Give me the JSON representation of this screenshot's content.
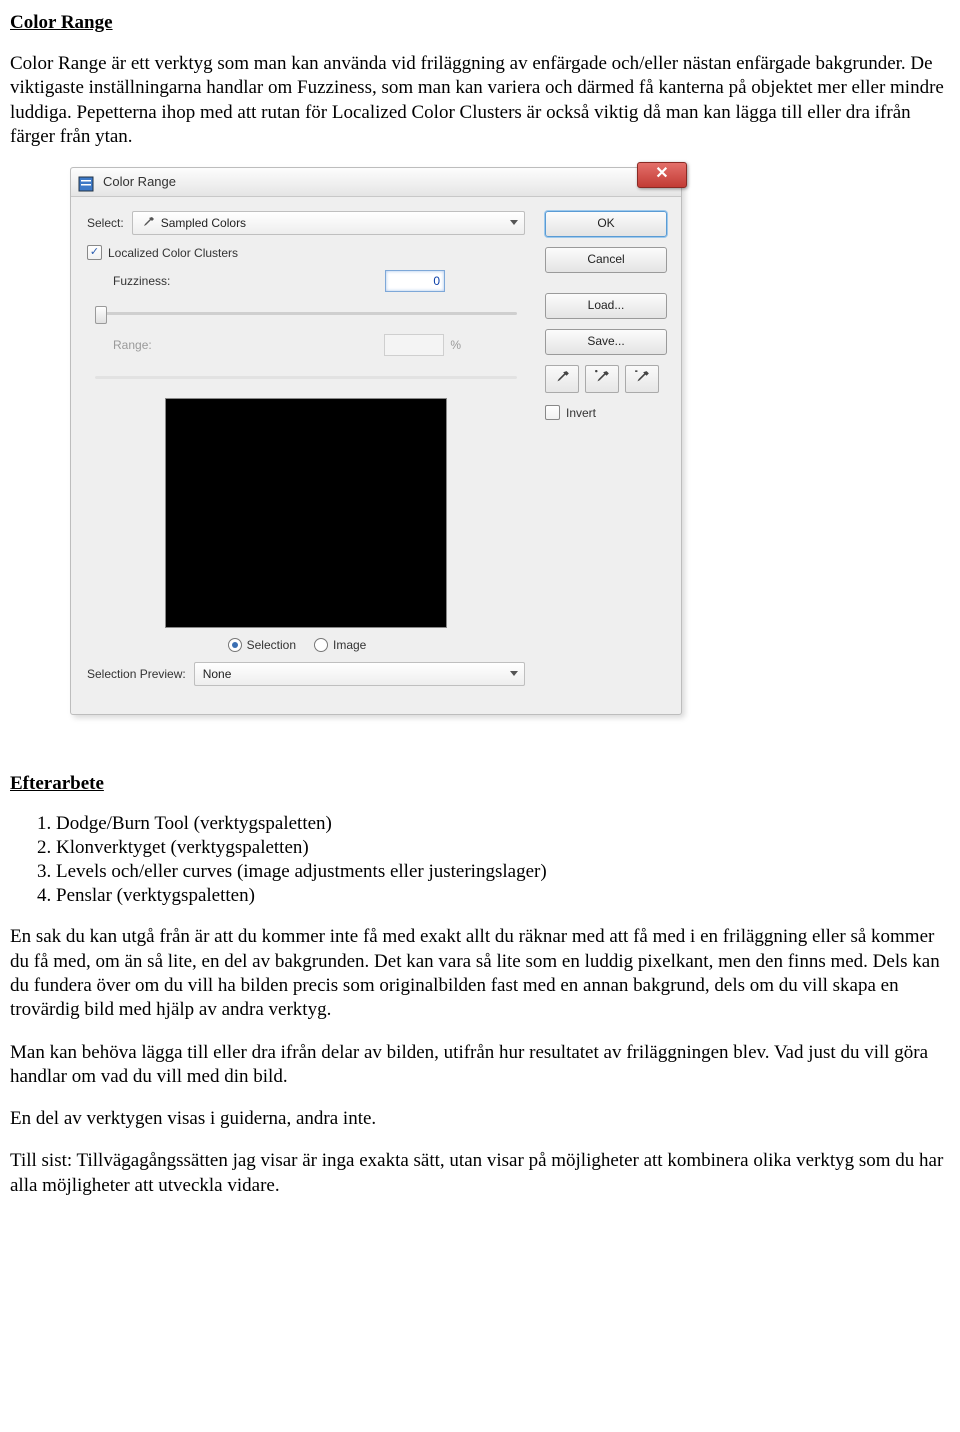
{
  "doc": {
    "title": "Color Range",
    "para1": "Color Range är ett verktyg som man kan använda vid friläggning av enfärgade och/eller nästan enfärgade bakgrunder. De viktigaste inställningarna handlar om Fuzziness, som man kan variera och därmed få kanterna på objektet mer eller mindre luddiga. Pepetterna ihop med att rutan för Localized Color Clusters är också viktig då man kan lägga till eller dra ifrån färger från ytan.",
    "sec2_title": "Efterarbete",
    "list": {
      "i1": "Dodge/Burn Tool (verktygspaletten)",
      "i2": "Klonverktyget (verktygspaletten)",
      "i3": "Levels och/eller curves (image adjustments eller justeringslager)",
      "i4": "Penslar (verktygspaletten)"
    },
    "para2": "En sak du kan utgå från är att du kommer inte få med exakt allt du räknar med att få med i en friläggning eller så kommer du få med, om än så lite, en del av bakgrunden. Det kan vara så lite som en luddig pixelkant, men den finns med. Dels kan du fundera över om du vill ha bilden precis som originalbilden fast med en annan bakgrund, dels om du vill skapa en trovärdig bild med hjälp av andra verktyg.",
    "para3": "Man kan behöva lägga till eller dra ifrån delar av bilden, utifrån hur resultatet av friläggningen blev. Vad just du vill göra handlar om vad du vill med din bild.",
    "para4": "En del av verktygen visas i guiderna, andra inte.",
    "para5": "Till sist: Tillvägagångssätten jag visar är inga exakta sätt, utan visar på möjligheter att kombinera olika verktyg som du har alla möjligheter att utveckla vidare."
  },
  "dialog": {
    "title": "Color Range",
    "select_label": "Select:",
    "select_value": "Sampled Colors",
    "localized_label": "Localized Color Clusters",
    "localized_checked": true,
    "fuzziness_label": "Fuzziness:",
    "fuzziness_value": "0",
    "range_label": "Range:",
    "range_value": "",
    "percent": "%",
    "radio_selection": "Selection",
    "radio_image": "Image",
    "prev_label": "Selection Preview:",
    "prev_value": "None",
    "ok": "OK",
    "cancel": "Cancel",
    "load": "Load...",
    "save": "Save...",
    "invert_label": "Invert",
    "invert_checked": false
  }
}
